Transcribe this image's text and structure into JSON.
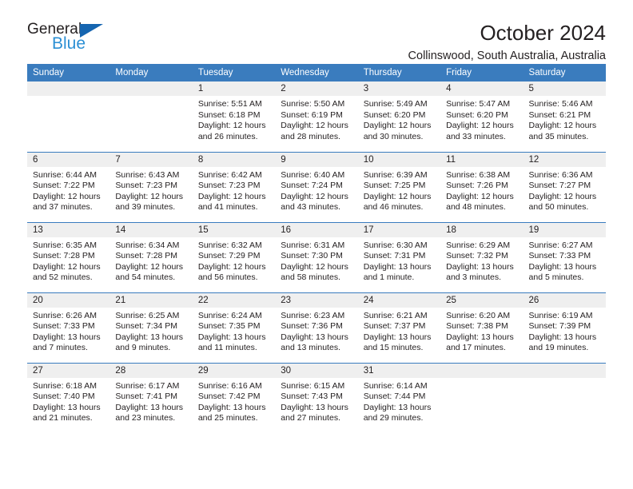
{
  "logo": {
    "word_one": "General",
    "word_two": "Blue",
    "triangle_color": "#1565b0",
    "blue_color": "#2b8fd4"
  },
  "header": {
    "title": "October 2024",
    "location": "Collinswood, South Australia, Australia"
  },
  "theme": {
    "header_blue": "#3a7cbe",
    "daynum_band": "#efefef",
    "text": "#231f20"
  },
  "weekday_headers": [
    "Sunday",
    "Monday",
    "Tuesday",
    "Wednesday",
    "Thursday",
    "Friday",
    "Saturday"
  ],
  "labels": {
    "sunrise_prefix": "Sunrise: ",
    "sunset_prefix": "Sunset: ",
    "daylight_prefix": "Daylight: "
  },
  "weeks": [
    [
      {
        "day": "",
        "sunrise": "",
        "sunset": "",
        "daylight_line1": "",
        "daylight_line2": "",
        "blank": true
      },
      {
        "day": "",
        "sunrise": "",
        "sunset": "",
        "daylight_line1": "",
        "daylight_line2": "",
        "blank": true
      },
      {
        "day": "1",
        "sunrise": "Sunrise: 5:51 AM",
        "sunset": "Sunset: 6:18 PM",
        "daylight_line1": "Daylight: 12 hours",
        "daylight_line2": "and 26 minutes."
      },
      {
        "day": "2",
        "sunrise": "Sunrise: 5:50 AM",
        "sunset": "Sunset: 6:19 PM",
        "daylight_line1": "Daylight: 12 hours",
        "daylight_line2": "and 28 minutes."
      },
      {
        "day": "3",
        "sunrise": "Sunrise: 5:49 AM",
        "sunset": "Sunset: 6:20 PM",
        "daylight_line1": "Daylight: 12 hours",
        "daylight_line2": "and 30 minutes."
      },
      {
        "day": "4",
        "sunrise": "Sunrise: 5:47 AM",
        "sunset": "Sunset: 6:20 PM",
        "daylight_line1": "Daylight: 12 hours",
        "daylight_line2": "and 33 minutes."
      },
      {
        "day": "5",
        "sunrise": "Sunrise: 5:46 AM",
        "sunset": "Sunset: 6:21 PM",
        "daylight_line1": "Daylight: 12 hours",
        "daylight_line2": "and 35 minutes."
      }
    ],
    [
      {
        "day": "6",
        "sunrise": "Sunrise: 6:44 AM",
        "sunset": "Sunset: 7:22 PM",
        "daylight_line1": "Daylight: 12 hours",
        "daylight_line2": "and 37 minutes."
      },
      {
        "day": "7",
        "sunrise": "Sunrise: 6:43 AM",
        "sunset": "Sunset: 7:23 PM",
        "daylight_line1": "Daylight: 12 hours",
        "daylight_line2": "and 39 minutes."
      },
      {
        "day": "8",
        "sunrise": "Sunrise: 6:42 AM",
        "sunset": "Sunset: 7:23 PM",
        "daylight_line1": "Daylight: 12 hours",
        "daylight_line2": "and 41 minutes."
      },
      {
        "day": "9",
        "sunrise": "Sunrise: 6:40 AM",
        "sunset": "Sunset: 7:24 PM",
        "daylight_line1": "Daylight: 12 hours",
        "daylight_line2": "and 43 minutes."
      },
      {
        "day": "10",
        "sunrise": "Sunrise: 6:39 AM",
        "sunset": "Sunset: 7:25 PM",
        "daylight_line1": "Daylight: 12 hours",
        "daylight_line2": "and 46 minutes."
      },
      {
        "day": "11",
        "sunrise": "Sunrise: 6:38 AM",
        "sunset": "Sunset: 7:26 PM",
        "daylight_line1": "Daylight: 12 hours",
        "daylight_line2": "and 48 minutes."
      },
      {
        "day": "12",
        "sunrise": "Sunrise: 6:36 AM",
        "sunset": "Sunset: 7:27 PM",
        "daylight_line1": "Daylight: 12 hours",
        "daylight_line2": "and 50 minutes."
      }
    ],
    [
      {
        "day": "13",
        "sunrise": "Sunrise: 6:35 AM",
        "sunset": "Sunset: 7:28 PM",
        "daylight_line1": "Daylight: 12 hours",
        "daylight_line2": "and 52 minutes."
      },
      {
        "day": "14",
        "sunrise": "Sunrise: 6:34 AM",
        "sunset": "Sunset: 7:28 PM",
        "daylight_line1": "Daylight: 12 hours",
        "daylight_line2": "and 54 minutes."
      },
      {
        "day": "15",
        "sunrise": "Sunrise: 6:32 AM",
        "sunset": "Sunset: 7:29 PM",
        "daylight_line1": "Daylight: 12 hours",
        "daylight_line2": "and 56 minutes."
      },
      {
        "day": "16",
        "sunrise": "Sunrise: 6:31 AM",
        "sunset": "Sunset: 7:30 PM",
        "daylight_line1": "Daylight: 12 hours",
        "daylight_line2": "and 58 minutes."
      },
      {
        "day": "17",
        "sunrise": "Sunrise: 6:30 AM",
        "sunset": "Sunset: 7:31 PM",
        "daylight_line1": "Daylight: 13 hours",
        "daylight_line2": "and 1 minute."
      },
      {
        "day": "18",
        "sunrise": "Sunrise: 6:29 AM",
        "sunset": "Sunset: 7:32 PM",
        "daylight_line1": "Daylight: 13 hours",
        "daylight_line2": "and 3 minutes."
      },
      {
        "day": "19",
        "sunrise": "Sunrise: 6:27 AM",
        "sunset": "Sunset: 7:33 PM",
        "daylight_line1": "Daylight: 13 hours",
        "daylight_line2": "and 5 minutes."
      }
    ],
    [
      {
        "day": "20",
        "sunrise": "Sunrise: 6:26 AM",
        "sunset": "Sunset: 7:33 PM",
        "daylight_line1": "Daylight: 13 hours",
        "daylight_line2": "and 7 minutes."
      },
      {
        "day": "21",
        "sunrise": "Sunrise: 6:25 AM",
        "sunset": "Sunset: 7:34 PM",
        "daylight_line1": "Daylight: 13 hours",
        "daylight_line2": "and 9 minutes."
      },
      {
        "day": "22",
        "sunrise": "Sunrise: 6:24 AM",
        "sunset": "Sunset: 7:35 PM",
        "daylight_line1": "Daylight: 13 hours",
        "daylight_line2": "and 11 minutes."
      },
      {
        "day": "23",
        "sunrise": "Sunrise: 6:23 AM",
        "sunset": "Sunset: 7:36 PM",
        "daylight_line1": "Daylight: 13 hours",
        "daylight_line2": "and 13 minutes."
      },
      {
        "day": "24",
        "sunrise": "Sunrise: 6:21 AM",
        "sunset": "Sunset: 7:37 PM",
        "daylight_line1": "Daylight: 13 hours",
        "daylight_line2": "and 15 minutes."
      },
      {
        "day": "25",
        "sunrise": "Sunrise: 6:20 AM",
        "sunset": "Sunset: 7:38 PM",
        "daylight_line1": "Daylight: 13 hours",
        "daylight_line2": "and 17 minutes."
      },
      {
        "day": "26",
        "sunrise": "Sunrise: 6:19 AM",
        "sunset": "Sunset: 7:39 PM",
        "daylight_line1": "Daylight: 13 hours",
        "daylight_line2": "and 19 minutes."
      }
    ],
    [
      {
        "day": "27",
        "sunrise": "Sunrise: 6:18 AM",
        "sunset": "Sunset: 7:40 PM",
        "daylight_line1": "Daylight: 13 hours",
        "daylight_line2": "and 21 minutes."
      },
      {
        "day": "28",
        "sunrise": "Sunrise: 6:17 AM",
        "sunset": "Sunset: 7:41 PM",
        "daylight_line1": "Daylight: 13 hours",
        "daylight_line2": "and 23 minutes."
      },
      {
        "day": "29",
        "sunrise": "Sunrise: 6:16 AM",
        "sunset": "Sunset: 7:42 PM",
        "daylight_line1": "Daylight: 13 hours",
        "daylight_line2": "and 25 minutes."
      },
      {
        "day": "30",
        "sunrise": "Sunrise: 6:15 AM",
        "sunset": "Sunset: 7:43 PM",
        "daylight_line1": "Daylight: 13 hours",
        "daylight_line2": "and 27 minutes."
      },
      {
        "day": "31",
        "sunrise": "Sunrise: 6:14 AM",
        "sunset": "Sunset: 7:44 PM",
        "daylight_line1": "Daylight: 13 hours",
        "daylight_line2": "and 29 minutes."
      },
      {
        "day": "",
        "sunrise": "",
        "sunset": "",
        "daylight_line1": "",
        "daylight_line2": "",
        "blank": true
      },
      {
        "day": "",
        "sunrise": "",
        "sunset": "",
        "daylight_line1": "",
        "daylight_line2": "",
        "blank": true
      }
    ]
  ]
}
